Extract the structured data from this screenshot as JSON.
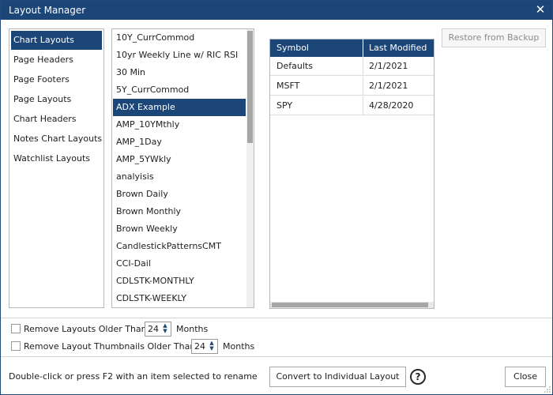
{
  "window": {
    "title": "Layout Manager",
    "close_glyph": "✕",
    "accent_color": "#1c4677"
  },
  "categories": [
    {
      "label": "Chart Layouts",
      "selected": true
    },
    {
      "label": "Page Headers",
      "selected": false
    },
    {
      "label": "Page Footers",
      "selected": false
    },
    {
      "label": "Page Layouts",
      "selected": false
    },
    {
      "label": "Chart Headers",
      "selected": false
    },
    {
      "label": "Notes Chart Layouts",
      "selected": false
    },
    {
      "label": "Watchlist Layouts",
      "selected": false
    }
  ],
  "layouts": [
    {
      "label": "10Y_CurrCommod",
      "selected": false
    },
    {
      "label": "10yr Weekly Line w/ RIC RSI",
      "selected": false
    },
    {
      "label": "30 Min",
      "selected": false
    },
    {
      "label": "5Y_CurrCommod",
      "selected": false
    },
    {
      "label": "ADX Example",
      "selected": true
    },
    {
      "label": "AMP_10YMthly",
      "selected": false
    },
    {
      "label": "AMP_1Day",
      "selected": false
    },
    {
      "label": "AMP_5YWkly",
      "selected": false
    },
    {
      "label": "analyisis",
      "selected": false
    },
    {
      "label": "Brown Daily",
      "selected": false
    },
    {
      "label": "Brown Monthly",
      "selected": false
    },
    {
      "label": "Brown Weekly",
      "selected": false
    },
    {
      "label": "CandlestickPatternsCMT",
      "selected": false
    },
    {
      "label": "CCI-Dail",
      "selected": false
    },
    {
      "label": "CDLSTK-MONTHLY",
      "selected": false
    },
    {
      "label": "CDLSTK-WEEKLY",
      "selected": false
    }
  ],
  "symbol_table": {
    "headers": {
      "symbol": "Symbol",
      "last_modified": "Last Modified"
    },
    "rows": [
      {
        "symbol": "Defaults",
        "last_modified": "2/1/2021"
      },
      {
        "symbol": "MSFT",
        "last_modified": "2/1/2021"
      },
      {
        "symbol": "SPY",
        "last_modified": "4/28/2020"
      }
    ]
  },
  "buttons": {
    "restore": "Restore from Backup",
    "convert": "Convert to Individual Layout",
    "close": "Close"
  },
  "options": {
    "remove_layouts": {
      "label": "Remove Layouts Older Than",
      "value": "24",
      "unit": "Months",
      "checked": false
    },
    "remove_thumbnails": {
      "label": "Remove Layout Thumbnails Older Than",
      "value": "24",
      "unit": "Months",
      "checked": false
    }
  },
  "footer": {
    "hint": "Double-click or press F2 with an item selected to rename",
    "help_glyph": "?"
  }
}
